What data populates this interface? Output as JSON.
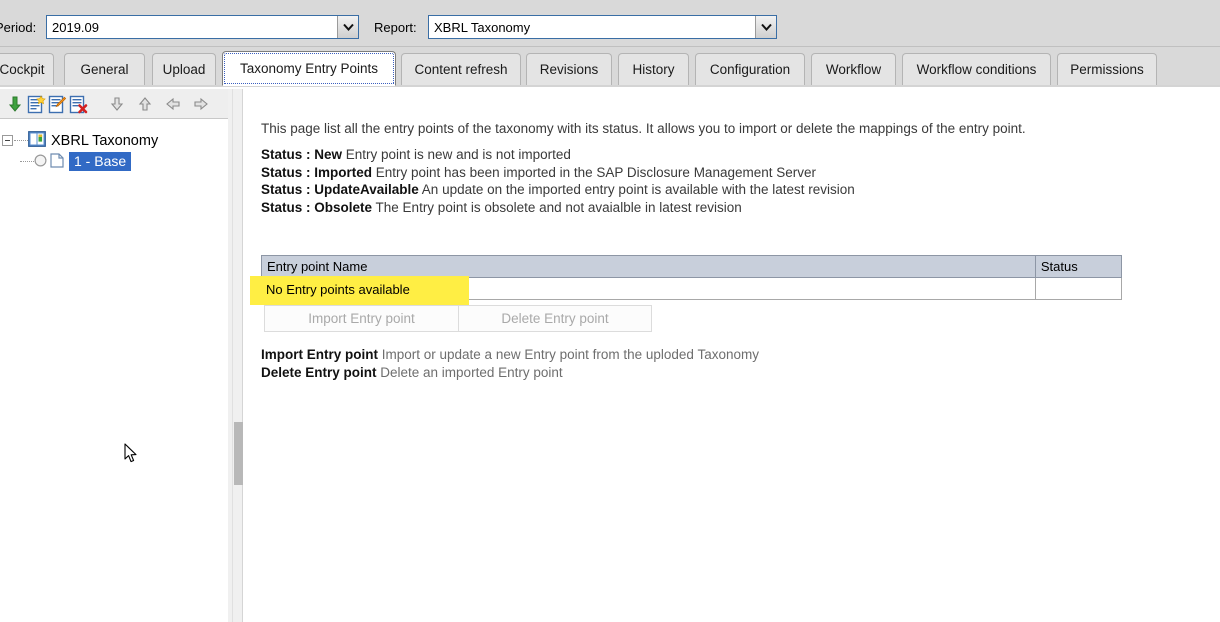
{
  "toolbar": {
    "period_label": "Period:",
    "period_value": "2019.09",
    "report_label": "Report:",
    "report_value": "XBRL Taxonomy"
  },
  "tabs": [
    {
      "label": "Cockpit",
      "active": false
    },
    {
      "label": "General",
      "active": false
    },
    {
      "label": "Upload",
      "active": false
    },
    {
      "label": "Taxonomy Entry Points",
      "active": true
    },
    {
      "label": "Content refresh",
      "active": false
    },
    {
      "label": "Revisions",
      "active": false
    },
    {
      "label": "History",
      "active": false
    },
    {
      "label": "Configuration",
      "active": false
    },
    {
      "label": "Workflow",
      "active": false
    },
    {
      "label": "Workflow conditions",
      "active": false
    },
    {
      "label": "Permissions",
      "active": false
    }
  ],
  "tree_toolbar": {
    "icons": [
      "download-arrow-icon",
      "new-document-icon",
      "edit-document-icon",
      "delete-document-icon",
      "move-down-icon",
      "move-up-icon",
      "move-left-icon",
      "move-right-icon"
    ]
  },
  "tree": {
    "root_label": "XBRL Taxonomy",
    "child_label": "1 - Base",
    "selected": "1 - Base"
  },
  "main": {
    "intro": "This page list all the entry points of the taxonomy with its status. It allows you to import or delete the mappings of the entry point.",
    "status_descriptions": [
      {
        "prefix": "Status : ",
        "name": "New",
        "text": " Entry point is new and is not imported"
      },
      {
        "prefix": "Status : ",
        "name": "Imported",
        "text": " Entry point has been imported in the SAP Disclosure Management Server"
      },
      {
        "prefix": "Status : ",
        "name": "UpdateAvailable",
        "text": " An update on the imported entry point is available with the latest revision"
      },
      {
        "prefix": "Status : ",
        "name": "Obsolete",
        "text": " The Entry point is obsolete and not avaialble in latest revision"
      }
    ],
    "table": {
      "headers": [
        "Entry point Name",
        "Status"
      ],
      "empty_message": "No Entry points available",
      "rows": []
    },
    "buttons": {
      "import_label": "Import Entry point",
      "delete_label": "Delete Entry point",
      "import_enabled": false,
      "delete_enabled": false
    },
    "notes": [
      {
        "name": "Import Entry point",
        "text": " Import or update a new Entry point from the uploded Taxonomy"
      },
      {
        "name": "Delete Entry point",
        "text": " Delete an imported Entry point"
      }
    ]
  },
  "colors": {
    "highlight": "#ffee44",
    "selection": "#316ac5",
    "table_header": "#c8cfdb",
    "chrome": "#d9d9d9",
    "combo_border": "#3a6ea5"
  }
}
